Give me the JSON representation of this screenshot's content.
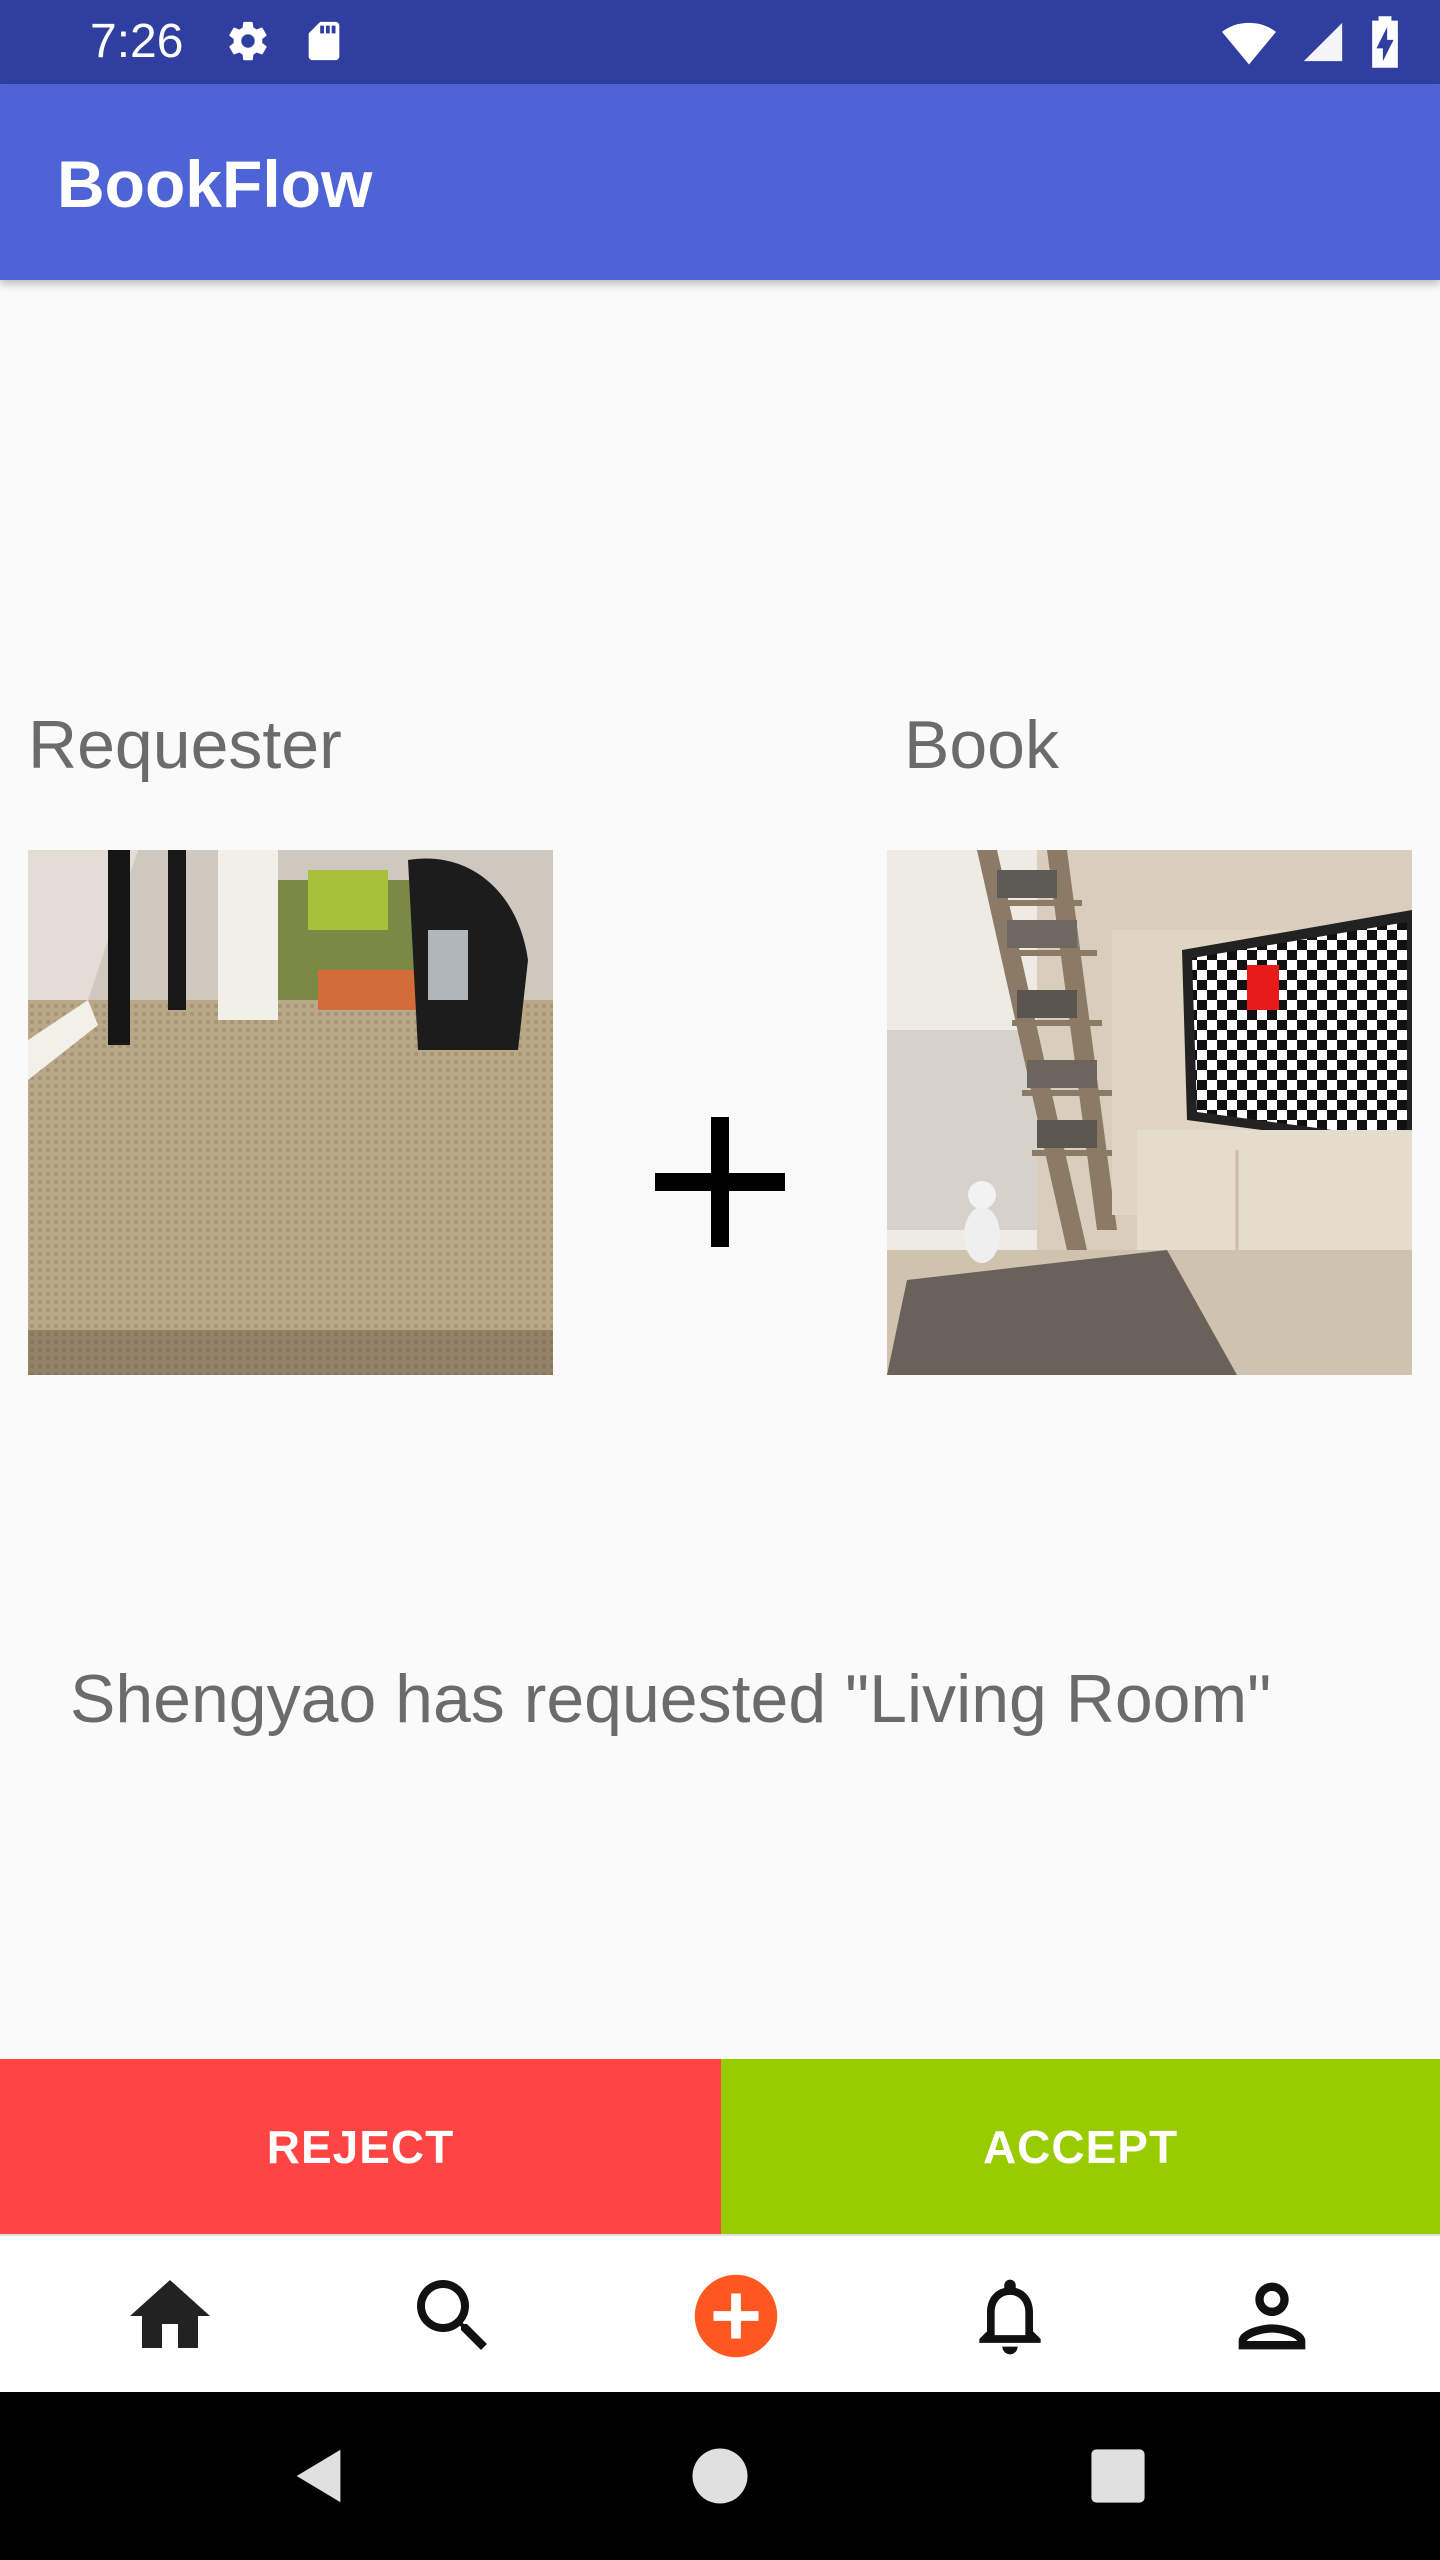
{
  "status_bar": {
    "time": "7:26",
    "icons_left": [
      "gear-icon",
      "sd-card-icon"
    ],
    "icons_right": [
      "wifi-icon",
      "signal-icon",
      "battery-charging-icon"
    ]
  },
  "app_bar": {
    "title": "BookFlow"
  },
  "labels": {
    "requester": "Requester",
    "book": "Book"
  },
  "images": {
    "requester": "photo of carpeted room floor with a backpack and table legs",
    "book": "photo of a living room with a bookshelf, a cat and a TV showing a checkerboard"
  },
  "message": "Shengyao has requested \"Living Room\"",
  "buttons": {
    "reject": "REJECT",
    "accept": "ACCEPT"
  },
  "colors": {
    "status_bar": "#303f9f",
    "app_bar": "#4e63d6",
    "reject": "#ff4444",
    "accept": "#99cc00",
    "add_icon": "#ff5722"
  },
  "bottom_nav": [
    "home-icon",
    "search-icon",
    "add-icon",
    "notifications-icon",
    "profile-icon"
  ],
  "system_nav": [
    "back-icon",
    "home-circle-icon",
    "recents-icon"
  ]
}
